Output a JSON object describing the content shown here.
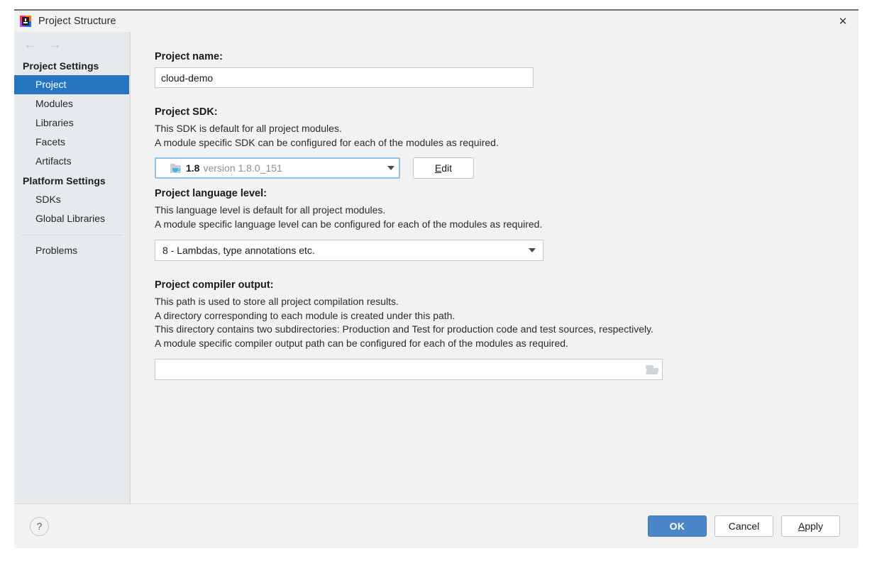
{
  "window": {
    "title": "Project Structure",
    "app_icon": "intellij-idea-logo",
    "close_label": "✕"
  },
  "sidebar": {
    "nav_back": "←",
    "nav_forward": "→",
    "groups": [
      {
        "header": "Project Settings",
        "items": [
          {
            "label": "Project",
            "selected": true
          },
          {
            "label": "Modules",
            "selected": false
          },
          {
            "label": "Libraries",
            "selected": false
          },
          {
            "label": "Facets",
            "selected": false
          },
          {
            "label": "Artifacts",
            "selected": false
          }
        ]
      },
      {
        "header": "Platform Settings",
        "items": [
          {
            "label": "SDKs",
            "selected": false
          },
          {
            "label": "Global Libraries",
            "selected": false
          }
        ]
      }
    ],
    "extra_items": [
      {
        "label": "Problems",
        "selected": false
      }
    ]
  },
  "content": {
    "project_name": {
      "label": "Project name:",
      "value": "cloud-demo",
      "placeholder": ""
    },
    "project_sdk": {
      "label": "Project SDK:",
      "desc_line1": "This SDK is default for all project modules.",
      "desc_line2": "A module specific SDK can be configured for each of the modules as required.",
      "selected_name": "1.8",
      "selected_detail": "version 1.8.0_151",
      "icon": "java-sdk-folder-icon",
      "edit_button": "Edit",
      "edit_button_mnemonic": "E",
      "edit_button_rest": "dit"
    },
    "language_level": {
      "label": "Project language level:",
      "desc_line1": "This language level is default for all project modules.",
      "desc_line2": "A module specific language level can be configured for each of the modules as required.",
      "selected": "8 - Lambdas, type annotations etc."
    },
    "compiler_output": {
      "label": "Project compiler output:",
      "desc_line1": "This path is used to store all project compilation results.",
      "desc_line2": "A directory corresponding to each module is created under this path.",
      "desc_line3": "This directory contains two subdirectories: Production and Test for production code and test sources, respectively.",
      "desc_line4": "A module specific compiler output path can be configured for each of the modules as required.",
      "value": "",
      "placeholder": "",
      "browse_icon": "folder-browse-icon"
    }
  },
  "footer": {
    "help_label": "?",
    "ok_label": "OK",
    "cancel_label": "Cancel",
    "apply_mnemonic": "A",
    "apply_rest": "pply"
  },
  "colors": {
    "selection_blue": "#2675bf",
    "primary_button_blue": "#4a86c8",
    "sidebar_bg": "#e6eaed",
    "dialog_bg": "#f2f2f2",
    "focus_border": "#8cc2eb"
  }
}
